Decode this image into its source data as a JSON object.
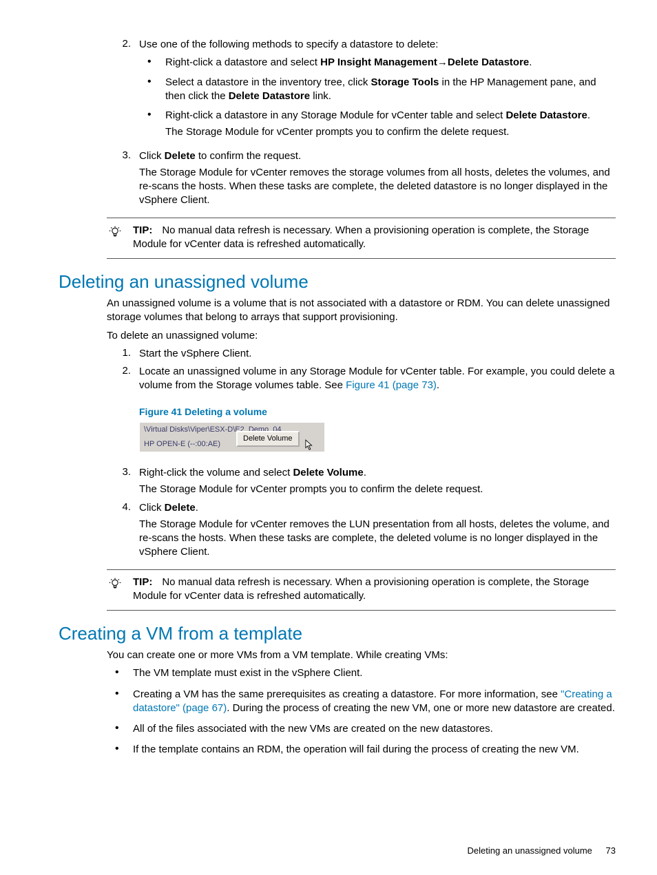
{
  "steps_a": {
    "s2": {
      "num": "2.",
      "text": "Use one of the following methods to specify a datastore to delete:",
      "bullets": [
        {
          "pre": "Right-click a datastore and select ",
          "b1": "HP Insight Management",
          "arrow": "→",
          "b2": "Delete Datastore",
          "post": "."
        },
        {
          "pre": "Select a datastore in the inventory tree, click ",
          "b1": "Storage Tools",
          "mid": " in the HP Management pane, and then click the ",
          "b2": "Delete Datastore",
          "post": " link."
        },
        {
          "pre": "Right-click a datastore in any Storage Module for vCenter table and select ",
          "b1": "Delete Datastore",
          "post": ".",
          "follow": "The Storage Module for vCenter prompts you to confirm the delete request."
        }
      ]
    },
    "s3": {
      "num": "3.",
      "pre": "Click ",
      "b": "Delete",
      "post": " to confirm the request.",
      "follow": "The Storage Module for vCenter removes the storage volumes from all hosts, deletes the volumes, and re-scans the hosts. When these tasks are complete, the deleted datastore is no longer displayed in the vSphere Client."
    }
  },
  "tip1": {
    "label": "TIP:",
    "text": "No manual data refresh is necessary. When a provisioning operation is complete, the Storage Module for vCenter data is refreshed automatically."
  },
  "section1": {
    "heading": "Deleting an unassigned volume",
    "p1": "An unassigned volume is a volume that is not associated with a datastore or RDM. You can delete unassigned storage volumes that belong to arrays that support provisioning.",
    "p2": "To delete an unassigned volume:",
    "s1": {
      "num": "1.",
      "text": "Start the vSphere Client."
    },
    "s2": {
      "num": "2.",
      "pre": "Locate an unassigned volume in any Storage Module for vCenter table. For example, you could delete a volume from the Storage volumes table. See ",
      "link": "Figure 41 (page 73)",
      "post": "."
    },
    "figcap": "Figure 41 Deleting a volume",
    "fig": {
      "row1": "\\Virtual Disks\\Viper\\ESX-D\\E2_Demo_04",
      "row2": "HP OPEN-E (--:00:AE)",
      "menu": "Delete Volume"
    },
    "s3": {
      "num": "3.",
      "pre": "Right-click the volume and select ",
      "b": "Delete Volume",
      "post": ".",
      "follow": "The Storage Module for vCenter prompts you to confirm the delete request."
    },
    "s4": {
      "num": "4.",
      "pre": "Click ",
      "b": "Delete",
      "post": ".",
      "follow": "The Storage Module for vCenter removes the LUN presentation from all hosts, deletes the volume, and re-scans the hosts. When these tasks are complete, the deleted volume is no longer displayed in the vSphere Client."
    }
  },
  "tip2": {
    "label": "TIP:",
    "text": "No manual data refresh is necessary. When a provisioning operation is complete, the Storage Module for vCenter data is refreshed automatically."
  },
  "section2": {
    "heading": "Creating a VM from a template",
    "p1": "You can create one or more VMs from a VM template. While creating VMs:",
    "bullets": {
      "b1": "The VM template must exist in the vSphere Client.",
      "b2_pre": "Creating a VM has the same prerequisites as creating a datastore. For more information, see ",
      "b2_link": "\"Creating a datastore\" (page 67)",
      "b2_post": ". During the process of creating the new VM, one or more new datastore are created.",
      "b3": "All of the files associated with the new VMs are created on the new datastores.",
      "b4": "If the template contains an RDM, the operation will fail during the process of creating the new VM."
    }
  },
  "footer": {
    "text": "Deleting an unassigned volume",
    "page": "73"
  }
}
